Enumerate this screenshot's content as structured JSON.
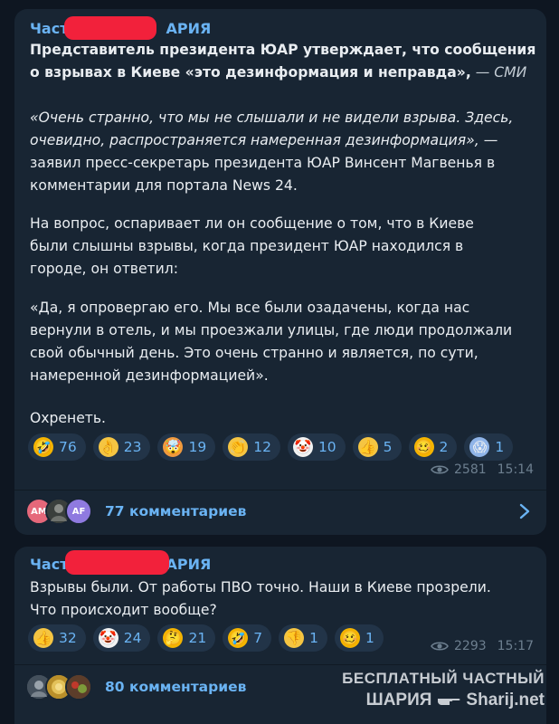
{
  "posts": [
    {
      "channel_prefix": "Частн",
      "channel_suffix": "АРИЯ",
      "headline": [
        "Представитель президента ЮАР утверждает, что сообщения",
        "о взрывах в Киеве «это дезинформация и неправда»,"
      ],
      "headline_source": " — СМИ",
      "quote_italic": [
        "«Очень странно, что мы не слышали и не видели взрыва. Здесь,",
        "очевидно, распространяется намеренная дезинформация»,"
      ],
      "quote_tail": " —",
      "attribution": [
        "заявил пресс-секретарь президента ЮАР Винсент Магвенья в",
        "комментарии для портала News 24."
      ],
      "question": [
        "На вопрос, оспаривает ли он сообщение о том, что в Киеве",
        "были слышны взрывы, когда президент ЮАР находился в",
        "городе, он ответил:"
      ],
      "answer": [
        " «Да, я опровергаю его. Мы все были озадачены, когда нас",
        "вернули в отель, и мы проезжали улицы, где люди продолжали",
        "свой обычный день. Это очень странно и является, по сути,",
        "намеренной дезинформацией»."
      ],
      "closing": "Охренеть.",
      "reactions": [
        {
          "emoji": "🤣",
          "count": "76",
          "icon": "rofl-icon"
        },
        {
          "emoji": "👌",
          "count": "23",
          "icon": "ok-hand-icon"
        },
        {
          "emoji": "🤯",
          "count": "19",
          "icon": "exploding-head-icon"
        },
        {
          "emoji": "👏",
          "count": "12",
          "icon": "clapping-icon"
        },
        {
          "emoji": "🤡",
          "count": "10",
          "icon": "clown-icon"
        },
        {
          "emoji": "👍",
          "count": "5",
          "icon": "thumbs-up-icon"
        },
        {
          "emoji": "🥴",
          "count": "2",
          "icon": "woozy-face-icon"
        },
        {
          "emoji": "😱",
          "count": "1",
          "icon": "screaming-face-icon"
        }
      ],
      "views": "2581",
      "time": "15:14",
      "comment_avatars": [
        "AM",
        "",
        "AF"
      ],
      "comments_label": "77 комментариев"
    },
    {
      "channel_prefix": "Частн",
      "channel_suffix": "АРИЯ",
      "body": [
        "Взрывы были. От работы ПВО точно. Наши в Киеве прозрели.",
        "Что происходит вообще?"
      ],
      "reactions": [
        {
          "emoji": "👍",
          "count": "32",
          "icon": "thumbs-up-icon"
        },
        {
          "emoji": "🤡",
          "count": "24",
          "icon": "clown-icon"
        },
        {
          "emoji": "🤔",
          "count": "21",
          "icon": "thinking-face-icon"
        },
        {
          "emoji": "🤣",
          "count": "7",
          "icon": "rofl-icon"
        },
        {
          "emoji": "👎",
          "count": "1",
          "icon": "thumbs-down-icon"
        },
        {
          "emoji": "🥴",
          "count": "1",
          "icon": "woozy-face-icon"
        }
      ],
      "views": "2293",
      "time": "15:17",
      "comments_label": "80 комментариев"
    }
  ],
  "watermark": {
    "line1": "БЕСПЛАТНЫЙ ЧАСТНЫЙ",
    "line2a": "ШАРИЯ",
    "line2b": "Sharij.net"
  },
  "colors": {
    "bg": "#0e1621",
    "bubble": "#182533",
    "accent": "#6ab3f3",
    "redaction": "#f2213b"
  }
}
